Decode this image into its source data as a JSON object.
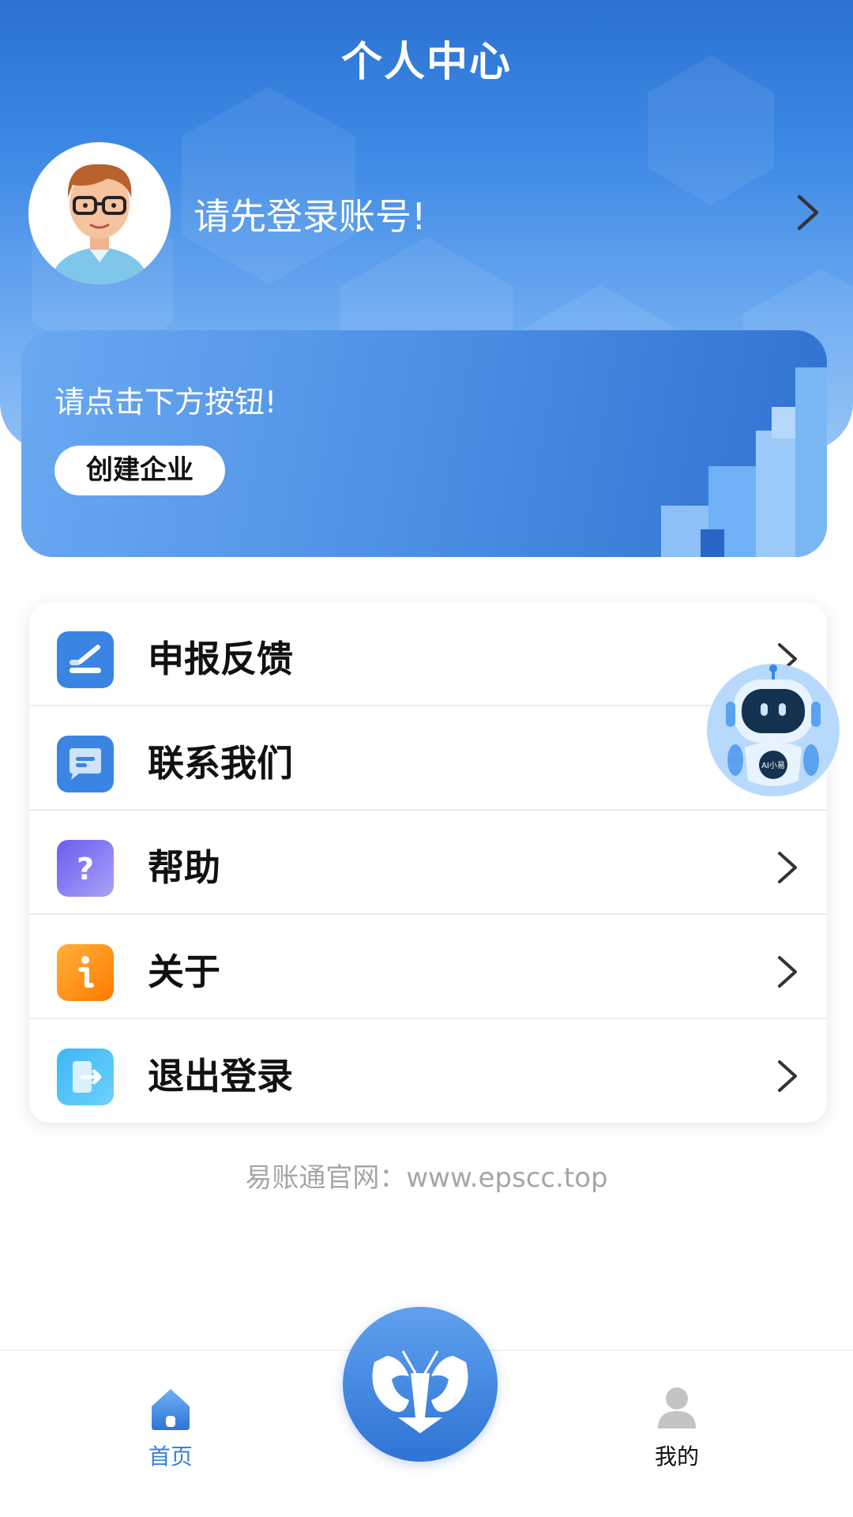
{
  "header": {
    "title": "个人中心",
    "login_prompt": "请先登录账号!"
  },
  "banner": {
    "text": "请点击下方按钮!",
    "button_label": "创建企业"
  },
  "menu": {
    "items": [
      {
        "label": "申报反馈",
        "icon": "report-edit-icon",
        "color": "#3a85e3"
      },
      {
        "label": "联系我们",
        "icon": "message-icon",
        "color": "#3a85e3"
      },
      {
        "label": "帮助",
        "icon": "help-question-icon",
        "color": "#7b6cf2"
      },
      {
        "label": "关于",
        "icon": "info-icon",
        "color": "#ff8a00"
      },
      {
        "label": "退出登录",
        "icon": "logout-icon",
        "color": "#34b1f2"
      }
    ]
  },
  "assistant": {
    "badge": "AI小易"
  },
  "footer": {
    "site": "易账通官网：www.epscc.top"
  },
  "tabbar": {
    "home_label": "首页",
    "mine_label": "我的",
    "active_color": "#3a7fde"
  }
}
